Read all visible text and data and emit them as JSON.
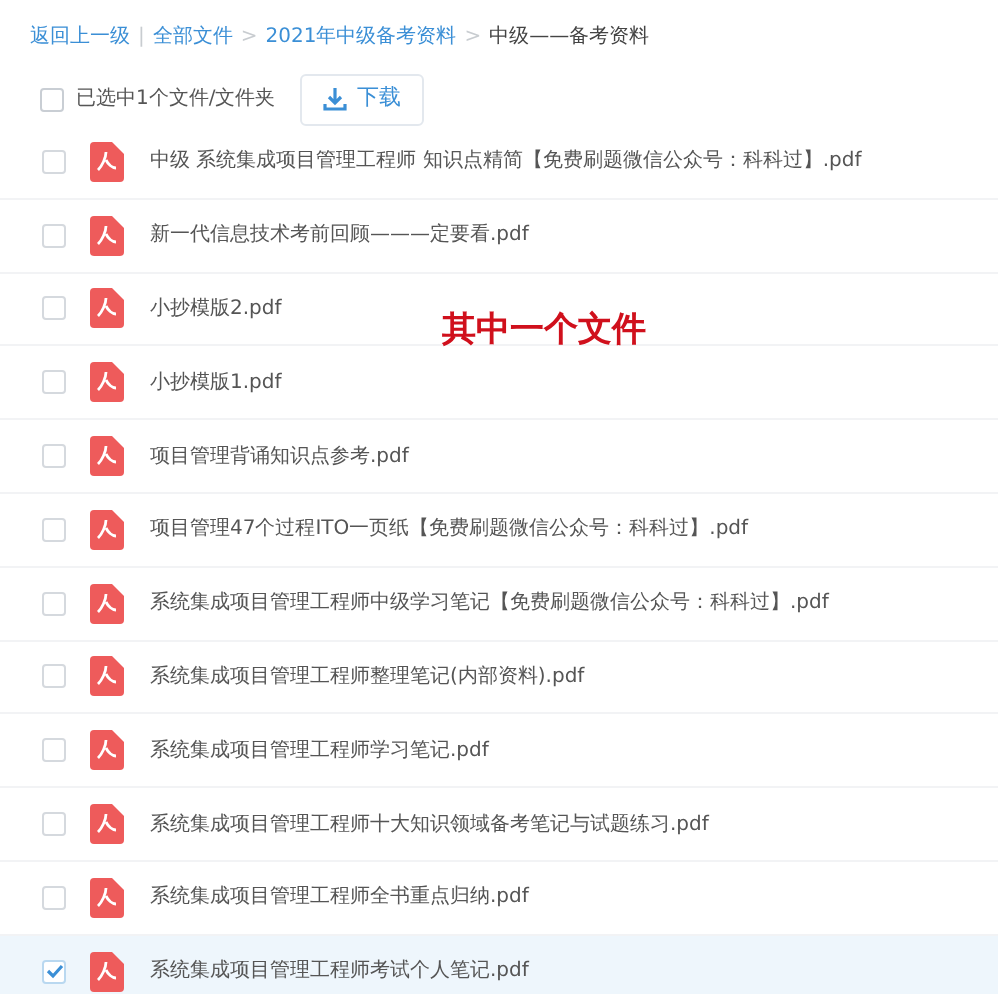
{
  "breadcrumb": [
    {
      "kind": "link",
      "text": "返回上一级"
    },
    {
      "kind": "separator",
      "text": "|"
    },
    {
      "kind": "link",
      "text": "全部文件"
    },
    {
      "kind": "separator",
      "text": ">"
    },
    {
      "kind": "link",
      "text": "2021年中级备考资料"
    },
    {
      "kind": "separator",
      "text": ">"
    },
    {
      "kind": "current",
      "text": "中级——备考资料"
    }
  ],
  "toolbar": {
    "select_all": {
      "checked": false,
      "label": "已选中1个文件/文件夹"
    },
    "download_button": "下载"
  },
  "files": [
    {
      "name": "中级 系统集成项目管理工程师 知识点精简【免费刷题微信公众号：科科过】.pdf",
      "selected": false
    },
    {
      "name": "新一代信息技术考前回顾———定要看.pdf",
      "selected": false
    },
    {
      "name": "小抄模版2.pdf",
      "selected": false
    },
    {
      "name": "小抄模版1.pdf",
      "selected": false
    },
    {
      "name": "项目管理背诵知识点参考.pdf",
      "selected": false
    },
    {
      "name": "项目管理47个过程ITO一页纸【免费刷题微信公众号：科科过】.pdf",
      "selected": false
    },
    {
      "name": "系统集成项目管理工程师中级学习笔记【免费刷题微信公众号：科科过】.pdf",
      "selected": false
    },
    {
      "name": "系统集成项目管理工程师整理笔记(内部资料).pdf",
      "selected": false
    },
    {
      "name": "系统集成项目管理工程师学习笔记.pdf",
      "selected": false
    },
    {
      "name": "系统集成项目管理工程师十大知识领域备考笔记与试题练习.pdf",
      "selected": false
    },
    {
      "name": "系统集成项目管理工程师全书重点归纳.pdf",
      "selected": false
    },
    {
      "name": "系统集成项目管理工程师考试个人笔记.pdf",
      "selected": true
    }
  ],
  "annotation": "其中一个文件"
}
